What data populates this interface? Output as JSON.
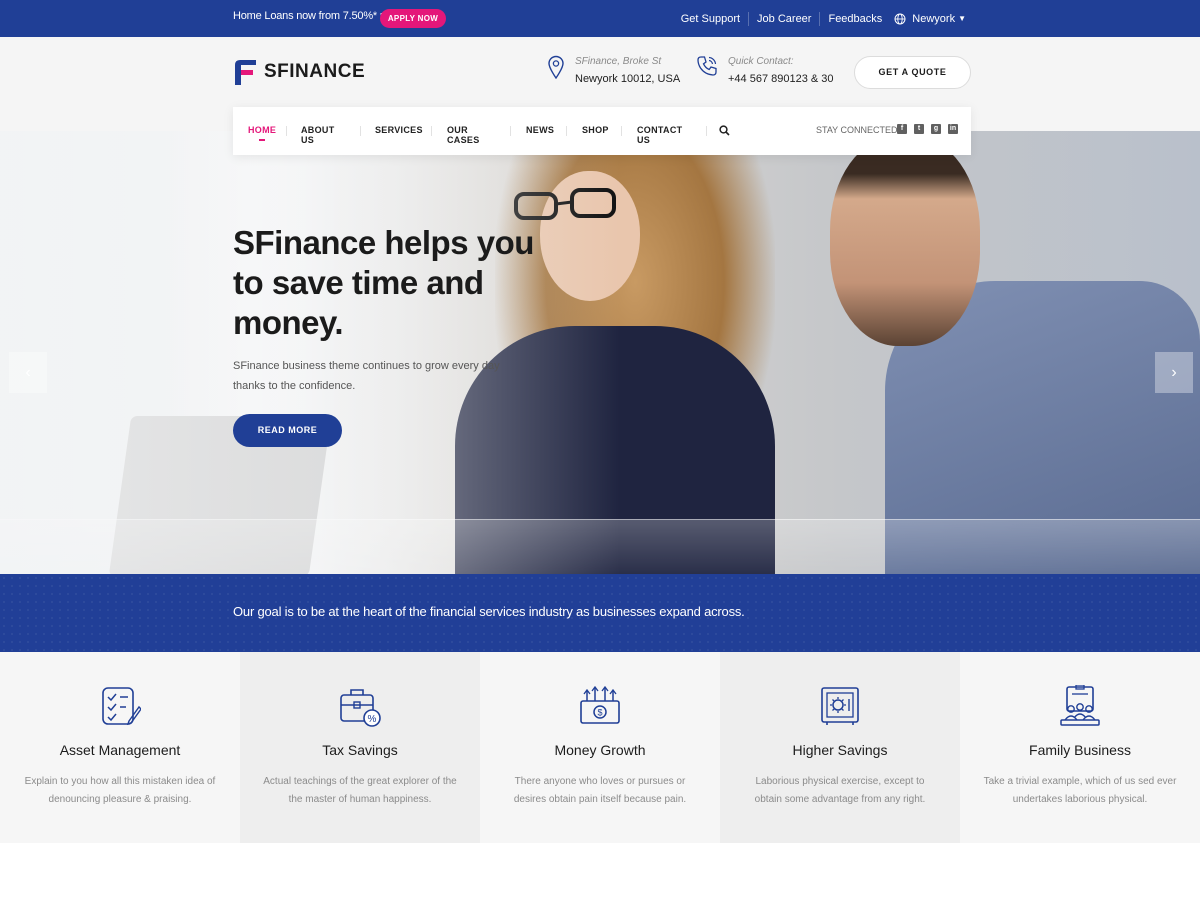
{
  "topbar": {
    "promo": "Home Loans now from 7.50%* p.a.",
    "apply_label": "APPLY NOW",
    "links": [
      "Get Support",
      "Job Career",
      "Feedbacks"
    ],
    "language": "Newyork",
    "accent": "#e4177a",
    "bg": "#203f96"
  },
  "header": {
    "logo_text": "SFINANCE",
    "address_label": "SFinance, Broke St",
    "address_value": "Newyork 10012, USA",
    "contact_label": "Quick Contact:",
    "contact_value": "+44 567 890123 & 30",
    "quote_label": "GET A QUOTE"
  },
  "nav": {
    "items": [
      "HOME",
      "ABOUT US",
      "SERVICES",
      "OUR CASES",
      "NEWS",
      "SHOP",
      "CONTACT US"
    ],
    "active": "HOME",
    "stay_label": "STAY CONNECTED:",
    "social": [
      "facebook-icon",
      "twitter-icon",
      "google-plus-icon",
      "linkedin-icon"
    ]
  },
  "hero": {
    "title": "SFinance helps you to save time and money.",
    "text": "SFinance business theme continues to grow every day thanks to the confidence.",
    "button": "READ MORE",
    "prev": "‹",
    "next": "›"
  },
  "goal": {
    "text": "Our goal is to be at the heart of the financial services industry as businesses expand across."
  },
  "features": [
    {
      "icon": "checklist-icon",
      "title": "Asset Management",
      "text": "Explain to you how all this mistaken idea of denouncing pleasure & praising."
    },
    {
      "icon": "briefcase-percent-icon",
      "title": "Tax Savings",
      "text": "Actual teachings of the great explorer of the the master of human happiness."
    },
    {
      "icon": "money-growth-icon",
      "title": "Money Growth",
      "text": "There anyone who loves or pursues or desires obtain pain itself because pain."
    },
    {
      "icon": "safe-icon",
      "title": "Higher Savings",
      "text": "Laborious physical exercise, except to obtain some advantage from any right."
    },
    {
      "icon": "family-business-icon",
      "title": "Family Business",
      "text": "Take a trivial example, which of us sed ever undertakes laborious physical."
    }
  ]
}
